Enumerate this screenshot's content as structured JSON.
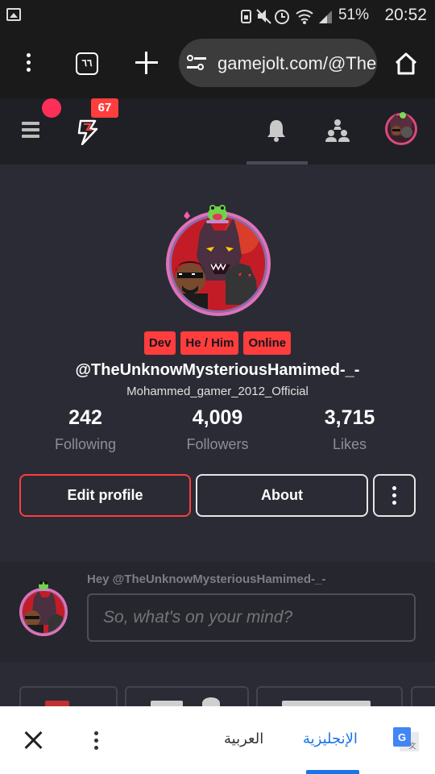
{
  "status_bar": {
    "battery": "51%",
    "time": "20:52"
  },
  "browser": {
    "tab_count": "٦٦",
    "url": "gamejolt.com/@TheUnknowMysteriousHamimed-_-"
  },
  "nav": {
    "notification_badge": "67"
  },
  "profile": {
    "tags": [
      "Dev",
      "He / Him",
      "Online"
    ],
    "username": "@TheUnknowMysteriousHamimed-_-",
    "display_name": "Mohammed_gamer_2012_Official",
    "stats": [
      {
        "value": "242",
        "label": "Following"
      },
      {
        "value": "4,009",
        "label": "Followers"
      },
      {
        "value": "3,715",
        "label": "Likes"
      }
    ],
    "edit_label": "Edit profile",
    "about_label": "About"
  },
  "compose": {
    "greeting": "Hey @TheUnknowMysteriousHamimed-_-",
    "placeholder": "So, what's on your mind?"
  },
  "translate_bar": {
    "source_lang": "العربية",
    "target_lang": "الإنجليزية"
  },
  "colors": {
    "accent_red": "#ff3d3d",
    "notification_pink": "#ff2f58",
    "link_blue": "#1a73e8",
    "background": "#2b2b35"
  }
}
